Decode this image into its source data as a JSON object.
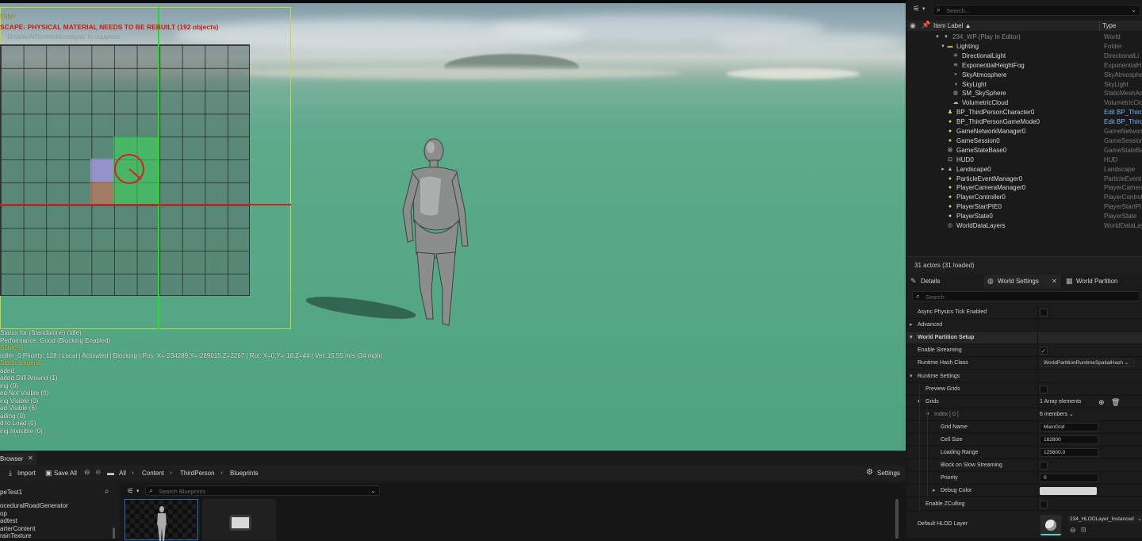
{
  "viewport": {
    "messages": {
      "line0": "Color",
      "warning": "SCAPE: PHYSICAL MATERIAL NEEDS TO BE REBUILT (192 objects)",
      "suppress": "'DisableAllScreenMessages' to suppress"
    },
    "debug": [
      "Status for (Standalone)  (Idle)",
      "Performance: Good (Blocking Enabled)",
      "Sources",
      "roller_0  Priority: 128 | Local | Activated | Blocking | Pos: X=-234289,Y=-289015,Z=2267 | Rot: X=0,Y=-18,Z=44 | Vel: 15.55 m/s (34 mph)",
      "Status Legend",
      "aded",
      "aded Still Around (1)",
      "ing (0)",
      "ed Not Visible (0)",
      "ing Visible (0)",
      "ad Visible (6)",
      "ading (0)",
      "d to Load (0)",
      "ing Invisible (0)"
    ]
  },
  "outliner": {
    "search_placeholder": "Search...",
    "col_label": "Item Label ▲",
    "col_type": "Type",
    "rows": [
      {
        "name": "234_WP (Play In Editor)",
        "type": "World",
        "icon": "world-icon",
        "glyph": "▾",
        "level": 0
      },
      {
        "name": "Lighting",
        "type": "Folder",
        "icon": "folder-icon",
        "glyph": "▬",
        "level": 1
      },
      {
        "name": "DirectionalLight",
        "type": "DirectionalLi",
        "icon": "directional-light-icon",
        "glyph": "✳",
        "level": 2
      },
      {
        "name": "ExponentialHeightFog",
        "type": "ExponentialH",
        "icon": "fog-icon",
        "glyph": "≋",
        "level": 2
      },
      {
        "name": "SkyAtmosphere",
        "type": "SkyAtmosphe",
        "icon": "sky-atmosphere-icon",
        "glyph": "◓",
        "level": 2
      },
      {
        "name": "SkyLight",
        "type": "SkyLight",
        "icon": "skylight-icon",
        "glyph": "◑",
        "level": 2
      },
      {
        "name": "SM_SkySphere",
        "type": "StaticMeshAc",
        "icon": "static-mesh-icon",
        "glyph": "◍",
        "level": 2
      },
      {
        "name": "VolumetricCloud",
        "type": "VolumetricClo",
        "icon": "cloud-icon",
        "glyph": "☁",
        "level": 2
      },
      {
        "name": "BP_ThirdPersonCharacter0",
        "type": "Edit BP_Third",
        "icon": "pawn-icon",
        "glyph": "♟",
        "level": 1,
        "link": true
      },
      {
        "name": "BP_ThirdPersonGameMode0",
        "type": "Edit BP_Third",
        "icon": "gamemode-icon",
        "glyph": "●",
        "level": 1,
        "link": true
      },
      {
        "name": "GameNetworkManager0",
        "type": "GameNetwork",
        "icon": "actor-icon",
        "glyph": "●",
        "level": 1
      },
      {
        "name": "GameSession0",
        "type": "GameSession",
        "icon": "actor-icon",
        "glyph": "●",
        "level": 1
      },
      {
        "name": "GameStateBase0",
        "type": "GameStateBa",
        "icon": "gamestate-icon",
        "glyph": "⊠",
        "level": 1
      },
      {
        "name": "HUD0",
        "type": "HUD",
        "icon": "hud-icon",
        "glyph": "⊡",
        "level": 1
      },
      {
        "name": "Landscape0",
        "type": "Landscape",
        "icon": "landscape-icon",
        "glyph": "▲",
        "level": 1,
        "expander": true
      },
      {
        "name": "ParticleEventManager0",
        "type": "ParticleEvent",
        "icon": "actor-icon",
        "glyph": "●",
        "level": 1
      },
      {
        "name": "PlayerCameraManager0",
        "type": "PlayerCamera",
        "icon": "actor-icon",
        "glyph": "●",
        "level": 1
      },
      {
        "name": "PlayerController0",
        "type": "PlayerControl",
        "icon": "actor-icon",
        "glyph": "●",
        "level": 1
      },
      {
        "name": "PlayerStartPIE0",
        "type": "PlayerStartPI",
        "icon": "actor-icon",
        "glyph": "●",
        "level": 1
      },
      {
        "name": "PlayerState0",
        "type": "PlayerState",
        "icon": "actor-icon",
        "glyph": "●",
        "level": 1
      },
      {
        "name": "WorldDataLayers",
        "type": "WorldDataLay",
        "icon": "data-layers-icon",
        "glyph": "◎",
        "level": 1
      }
    ],
    "footer": "31 actors (31 loaded)"
  },
  "details": {
    "tabs": [
      {
        "label": "Details",
        "icon": "pencil-icon",
        "glyph": "✎"
      },
      {
        "label": "World Settings",
        "icon": "globe-icon",
        "glyph": "◍",
        "active": true
      },
      {
        "label": "World Partition",
        "icon": "grid-icon",
        "glyph": "▦"
      }
    ],
    "search_placeholder": "Search",
    "rows": [
      {
        "label": "Async Physics Tick Enabled",
        "indent": 14,
        "kind": "checkbox",
        "checked": false
      },
      {
        "label": "Advanced",
        "indent": 14,
        "kind": "expander",
        "arrow": "▸"
      },
      {
        "label": "World Partition Setup",
        "indent": 14,
        "kind": "section",
        "arrow": "▾"
      },
      {
        "label": "Enable Streaming",
        "indent": 14,
        "kind": "checkbox",
        "checked": true
      },
      {
        "label": "Runtime Hash Class",
        "indent": 14,
        "kind": "dropdown",
        "value": "WorldPartitionRuntimeSpatialHash"
      },
      {
        "label": "Runtime Settings",
        "indent": 14,
        "kind": "expander",
        "arrow": "▾"
      },
      {
        "label": "Preview Grids",
        "indent": 24,
        "kind": "checkbox",
        "checked": false
      },
      {
        "label": "Grids",
        "indent": 24,
        "kind": "array",
        "arrow": "▾",
        "value": "1 Array elements"
      },
      {
        "label": "Index [ 0 ]",
        "indent": 35,
        "kind": "members",
        "arrow": "▾",
        "value": "6 members"
      },
      {
        "label": "Grid Name",
        "indent": 43,
        "kind": "text",
        "value": "MainGrid"
      },
      {
        "label": "Cell Size",
        "indent": 43,
        "kind": "text",
        "value": "182800"
      },
      {
        "label": "Loading Range",
        "indent": 43,
        "kind": "text",
        "value": "125600.0"
      },
      {
        "label": "Block on Slow Streaming",
        "indent": 43,
        "kind": "checkbox",
        "checked": false
      },
      {
        "label": "Priority",
        "indent": 43,
        "kind": "text",
        "value": "0"
      },
      {
        "label": "Debug Color",
        "indent": 43,
        "kind": "color",
        "arrow": "▸",
        "value": ""
      },
      {
        "label": "Enable ZCulling",
        "indent": 24,
        "kind": "checkbox",
        "checked": false
      }
    ],
    "hlod": {
      "label": "Default HLOD Layer",
      "value": "234_HLODLayer_Instanced"
    }
  },
  "content_browser": {
    "tab_label": "Browser",
    "import_label": "Import",
    "save_all_label": "Save All",
    "breadcrumb": [
      "All",
      "Content",
      "ThirdPerson",
      "Blueprints"
    ],
    "settings_label": "Settings",
    "tree_title": "peTest1",
    "tree_items": [
      "oceduralRoadGenerator",
      "op",
      "adtest",
      "arterContent",
      "rainTexture"
    ],
    "search_placeholder": "Search Blueprints"
  },
  "colors": {
    "warning": "#e23b1f",
    "grid_green_line": "#22dd22",
    "grid_red_line": "#d42020",
    "link": "#6fb7ff",
    "check": "#5aa7ff"
  }
}
